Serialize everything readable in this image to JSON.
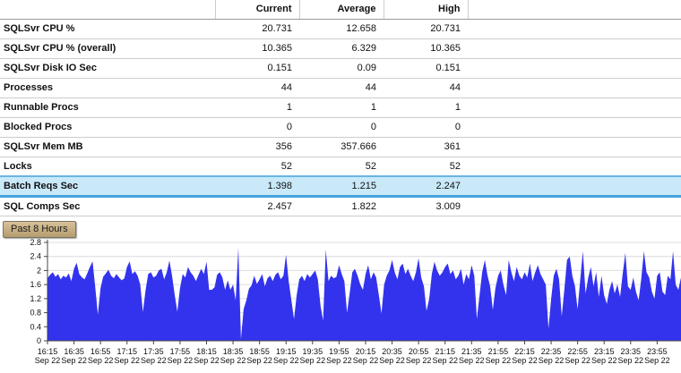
{
  "table": {
    "columns": [
      "Current",
      "Average",
      "High"
    ],
    "rows": [
      {
        "label": "SQLSvr CPU %",
        "current": "20.731",
        "average": "12.658",
        "high": "20.731"
      },
      {
        "label": "SQLSvr CPU % (overall)",
        "current": "10.365",
        "average": "6.329",
        "high": "10.365"
      },
      {
        "label": "SQLSvr Disk IO Sec",
        "current": "0.151",
        "average": "0.09",
        "high": "0.151"
      },
      {
        "label": "Processes",
        "current": "44",
        "average": "44",
        "high": "44"
      },
      {
        "label": "Runnable Procs",
        "current": "1",
        "average": "1",
        "high": "1"
      },
      {
        "label": "Blocked Procs",
        "current": "0",
        "average": "0",
        "high": "0"
      },
      {
        "label": "SQLSvr Mem MB",
        "current": "356",
        "average": "357.666",
        "high": "361"
      },
      {
        "label": "Locks",
        "current": "52",
        "average": "52",
        "high": "52"
      },
      {
        "label": "Batch Reqs Sec",
        "current": "1.398",
        "average": "1.215",
        "high": "2.247",
        "highlighted": true
      },
      {
        "label": "SQL Comps Sec",
        "current": "2.457",
        "average": "1.822",
        "high": "3.009"
      }
    ]
  },
  "time_range_button": {
    "label": "Past 8 Hours"
  },
  "colors": {
    "highlight_bg": "#C9E9F9",
    "highlight_border": "#44A3DD",
    "area_fill": "#3333EE",
    "button_bg": "#C3AA7E"
  },
  "chart_data": {
    "type": "area",
    "title": "",
    "xlabel": "",
    "ylabel": "",
    "fill_color": "#3333EE",
    "grid": true,
    "y_max": 2.8,
    "y_ticks": [
      "0",
      "0.4",
      "0.8",
      "1.2",
      "1.6",
      "2",
      "2.4",
      "2.8"
    ],
    "x_tick_times": [
      "16:15",
      "16:35",
      "16:55",
      "17:15",
      "17:35",
      "17:55",
      "18:15",
      "18:35",
      "18:55",
      "19:15",
      "19:35",
      "19:55",
      "20:15",
      "20:35",
      "20:55",
      "21:15",
      "21:35",
      "21:55",
      "22:15",
      "22:35",
      "22:55",
      "23:15",
      "23:35",
      "23:55"
    ],
    "x_tick_date": "Sep 22",
    "x_tick_interval_min": 20,
    "x_total_minutes": 478,
    "values": [
      1.78,
      1.88,
      1.95,
      1.82,
      1.9,
      1.75,
      1.85,
      1.8,
      1.92,
      1.7,
      2.05,
      2.22,
      1.9,
      1.8,
      1.75,
      1.92,
      2.1,
      2.26,
      1.55,
      0.75,
      1.5,
      1.82,
      1.92,
      2.02,
      1.85,
      1.78,
      1.9,
      1.8,
      1.72,
      1.78,
      2.1,
      2.26,
      1.9,
      1.98,
      1.85,
      1.6,
      0.82,
      1.45,
      1.9,
      1.95,
      1.8,
      1.85,
      2.0,
      2.05,
      1.75,
      1.95,
      2.28,
      1.85,
      1.3,
      0.83,
      1.5,
      1.9,
      1.8,
      2.1,
      1.95,
      1.85,
      1.7,
      1.88,
      2.05,
      1.9,
      2.25,
      1.45,
      1.45,
      1.52,
      1.88,
      1.95,
      1.8,
      1.45,
      1.72,
      1.45,
      1.6,
      1.15,
      2.65,
      0.05,
      0.9,
      1.15,
      1.48,
      1.58,
      1.85,
      1.62,
      1.75,
      1.9,
      1.55,
      1.78,
      1.85,
      1.7,
      1.88,
      1.95,
      1.75,
      1.85,
      2.45,
      1.7,
      1.15,
      0.62,
      1.3,
      1.75,
      1.85,
      1.7,
      1.9,
      1.8,
      1.9,
      2.0,
      1.75,
      1.0,
      0.58,
      2.6,
      1.7,
      1.85,
      1.78,
      1.82,
      2.15,
      1.9,
      1.7,
      0.8,
      1.35,
      1.95,
      2.05,
      1.85,
      1.6,
      1.45,
      1.9,
      2.15,
      1.75,
      1.95,
      1.8,
      1.3,
      0.78,
      1.6,
      1.85,
      2.0,
      2.3,
      1.95,
      1.75,
      2.1,
      2.2,
      1.9,
      2.05,
      1.85,
      1.7,
      1.95,
      2.35,
      1.8,
      1.55,
      0.85,
      1.2,
      1.9,
      2.25,
      2.0,
      1.85,
      1.95,
      2.1,
      2.2,
      1.9,
      2.0,
      1.75,
      1.85,
      2.05,
      1.6,
      1.9,
      1.75,
      2.15,
      1.85,
      0.62,
      1.3,
      1.95,
      2.3,
      1.85,
      1.55,
      0.88,
      1.5,
      1.85,
      2.0,
      1.6,
      1.3,
      2.3,
      1.95,
      1.7,
      2.1,
      1.85,
      1.75,
      1.95,
      1.8,
      2.2,
      1.7,
      1.95,
      2.15,
      1.9,
      1.75,
      1.6,
      0.35,
      1.2,
      1.85,
      2.05,
      1.75,
      0.7,
      1.45,
      2.3,
      2.4,
      1.85,
      1.55,
      0.9,
      1.75,
      2.55,
      1.35,
      1.8,
      2.1,
      1.55,
      1.95,
      1.25,
      1.85,
      1.3,
      1.05,
      1.45,
      1.7,
      1.35,
      1.6,
      1.25,
      1.9,
      2.5,
      1.55,
      1.45,
      1.8,
      1.4,
      1.15,
      1.75,
      2.55,
      1.95,
      1.8,
      1.4,
      1.2,
      1.85,
      1.95,
      1.4,
      1.3,
      1.85,
      1.75,
      2.55,
      1.6,
      1.45,
      1.8
    ]
  }
}
